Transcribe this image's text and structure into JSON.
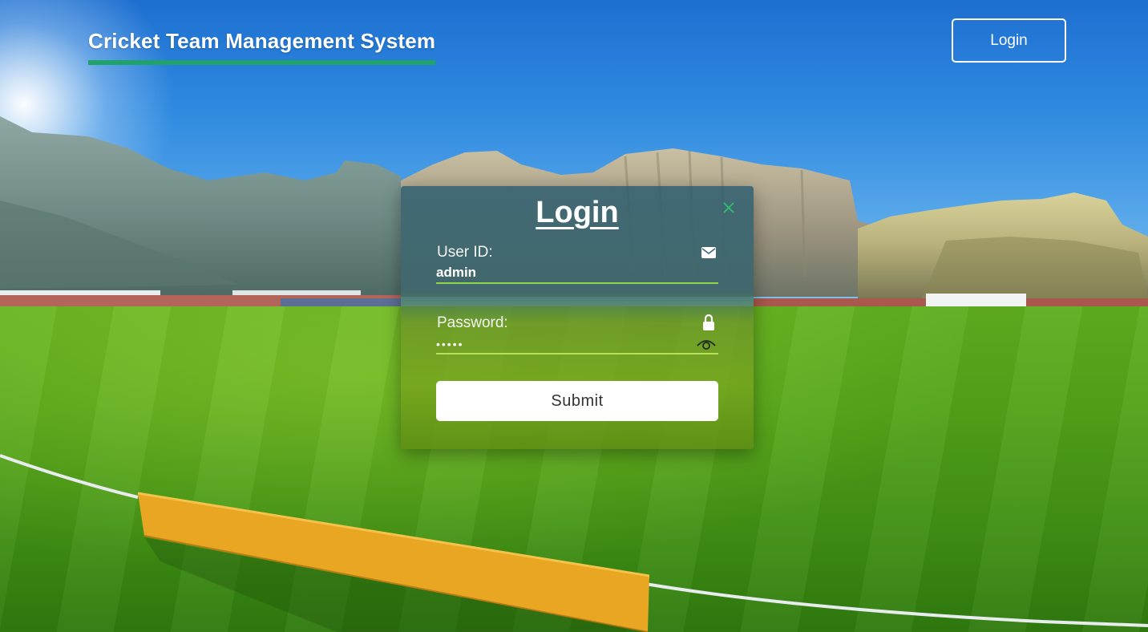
{
  "header": {
    "brand_title": "Cricket Team Management System",
    "login_button_label": "Login"
  },
  "login_modal": {
    "title": "Login",
    "close_icon": "close-x-icon",
    "user_id": {
      "label": "User ID:",
      "value": "admin",
      "icon": "envelope-icon"
    },
    "password": {
      "label": "Password:",
      "masked_value": "•••••",
      "icon": "lock-icon",
      "toggle_icon": "eye-icon"
    },
    "submit_label": "Submit"
  },
  "colors": {
    "brand_underline": "#1fa36b",
    "close_icon": "#2fbf6a",
    "input_underline": "#8fd84a",
    "submit_background": "#ffffff"
  }
}
